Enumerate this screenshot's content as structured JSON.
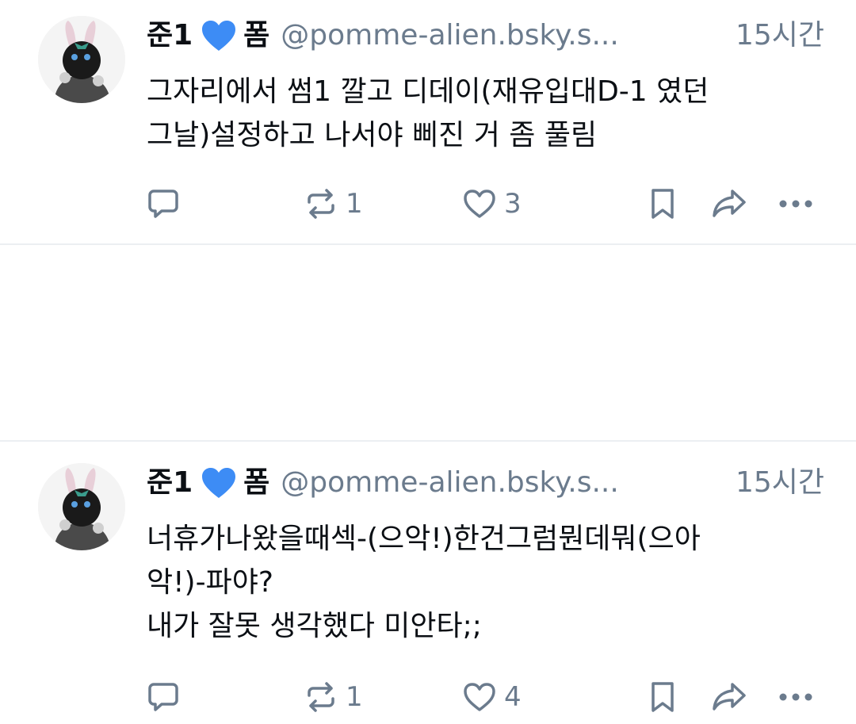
{
  "posts": [
    {
      "display_name": "준1",
      "name_suffix": "폼",
      "handle": "@pomme-alien.bsky.s...",
      "time": "15시간",
      "lines": [
        "그자리에서 썸1 깔고 디데이(재유입대D-1 였던",
        "그날)설정하고 나서야 삐진 거 좀 풀림"
      ],
      "reposts": "1",
      "likes": "3"
    },
    {
      "display_name": "준1",
      "name_suffix": "폼",
      "handle": "@pomme-alien.bsky.s...",
      "time": "15시간",
      "lines": [
        "너휴가나왔을때섹-(으악!)한건그럼뭔데뭐(으아",
        "악!)-파야?",
        "내가 잘못 생각했다 미안타;;"
      ],
      "reposts": "1",
      "likes": "4"
    }
  ],
  "icons": {
    "reply": "speech-bubble-icon",
    "repost": "repost-arrows-icon",
    "like": "heart-outline-icon",
    "bookmark": "bookmark-icon",
    "share": "share-arrow-icon",
    "more": "ellipsis-icon",
    "badge": "blue-heart-icon"
  },
  "colors": {
    "text": "#0b0f14",
    "muted": "#6b7b8d",
    "badge": "#3d8cf5",
    "divider": "#eceff2"
  }
}
